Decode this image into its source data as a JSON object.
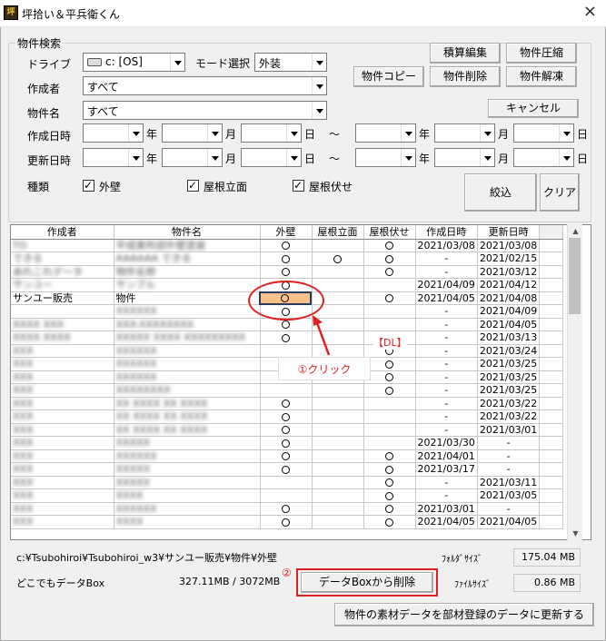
{
  "window": {
    "title": "坪拾い＆平兵衛くん",
    "icon": "app-logo-icon",
    "close": "×"
  },
  "search": {
    "legend": "物件検索",
    "drive_label": "ドライブ",
    "drive_value": "c: [OS]",
    "mode_label": "モード選択",
    "mode_value": "外装",
    "author_label": "作成者",
    "author_value": "すべて",
    "name_label": "物件名",
    "name_value": "すべて",
    "created_label": "作成日時",
    "updated_label": "更新日時",
    "year": "年",
    "month": "月",
    "day": "日",
    "tilde": "～",
    "type_label": "種類",
    "types": [
      "外壁",
      "屋根立面",
      "屋根伏せ"
    ],
    "filter_btn": "絞込",
    "clear_btn": "クリア"
  },
  "buttons": {
    "estimate": "積算編集",
    "compress": "物件圧縮",
    "copy": "物件コピー",
    "delete": "物件削除",
    "extract": "物件解凍",
    "cancel": "キャンセル"
  },
  "table": {
    "headers": [
      "作成者",
      "物件名",
      "外壁",
      "屋根立面",
      "屋根伏せ",
      "作成日時",
      "更新日時"
    ],
    "rows": [
      [
        "TO",
        "平成某所邸外壁塗装",
        "○",
        "",
        "○",
        "2021/03/08",
        "2021/03/08"
      ],
      [
        "できる",
        "AAAAAA できる",
        "○",
        "○",
        "○",
        "-",
        "2021/02/15"
      ],
      [
        "あれこれデータ",
        "物件名称",
        "○",
        "",
        "○",
        "-",
        "2021/03/12"
      ],
      [
        "サンユー",
        "サンプル",
        "○",
        "",
        "",
        "2021/04/09",
        "2021/04/12"
      ],
      [
        "サンユー販売",
        "物件",
        "○",
        "",
        "○",
        "2021/04/05",
        "2021/04/08"
      ],
      [
        "",
        "XXXXXX",
        "○",
        "",
        "",
        "-",
        "2021/04/09"
      ],
      [
        "XXXX XXX",
        "XXX-XXXXXXXX",
        "○",
        "",
        "",
        "-",
        "2021/04/05"
      ],
      [
        "XXXX XXXX",
        "XXXXX XXXX XXXXXXXXX",
        "○",
        "",
        "",
        "-",
        "2021/03/13"
      ],
      [
        "XXX",
        "XXXXXX",
        "",
        "",
        "○",
        "-",
        "2021/03/24"
      ],
      [
        "XXX",
        "XXXXXX",
        "",
        "",
        "○",
        "-",
        "2021/03/25"
      ],
      [
        "XXX",
        "XXXXXX",
        "",
        "",
        "○",
        "-",
        "2021/03/25"
      ],
      [
        "XXX",
        "XXXXXXXX",
        "",
        "",
        "○",
        "-",
        "2021/03/25"
      ],
      [
        "XXX",
        "XX XXXX XX XXXX",
        "○",
        "",
        "",
        "-",
        "2021/03/22"
      ],
      [
        "XXX",
        "XX XXXX XX XXXX",
        "○",
        "",
        "",
        "-",
        "2021/03/22"
      ],
      [
        "XXX",
        "XX XXXX XX XXXX",
        "○",
        "",
        "",
        "-",
        "2021/03/01"
      ],
      [
        "XXX",
        "XXXXX",
        "○",
        "",
        "",
        "2021/03/30",
        "-"
      ],
      [
        "XXX",
        "XXXXXX",
        "○",
        "",
        "○",
        "2021/04/01",
        "-"
      ],
      [
        "XXX",
        "XXXXX",
        "○",
        "",
        "○",
        "2021/03/17",
        "-"
      ],
      [
        "XXX",
        "XXXXX",
        "",
        "",
        "○",
        "-",
        "2021/03/11"
      ],
      [
        "XXX",
        "XXXX",
        "",
        "",
        "○",
        "-",
        "2021/03/05"
      ],
      [
        "XXX",
        "XXXXXX",
        "○",
        "",
        "○",
        "2021/03/01",
        "-"
      ],
      [
        "XXX",
        "XXXX",
        "○",
        "",
        "○",
        "2021/04/05",
        "2021/04/05"
      ]
    ]
  },
  "annotations": {
    "click": "①クリック",
    "dl": "【DL】",
    "step2": "②"
  },
  "footer": {
    "path": "c:¥Tsubohiroi¥Tsubohiroi_w3¥サンユー販売¥物件¥外壁",
    "folder_size_label": "ﾌｫﾙﾀﾞｻｲｽﾞ",
    "folder_size": "175.04 MB",
    "databox_label": "どこでもデータBox",
    "databox_usage": "327.11MB / 3072MB",
    "delete_btn": "データBoxから削除",
    "file_size_label": "ﾌｧｲﾙｻｲｽﾞ",
    "file_size": "0.86 MB",
    "update_btn": "物件の素材データを部材登録のデータに更新する"
  }
}
